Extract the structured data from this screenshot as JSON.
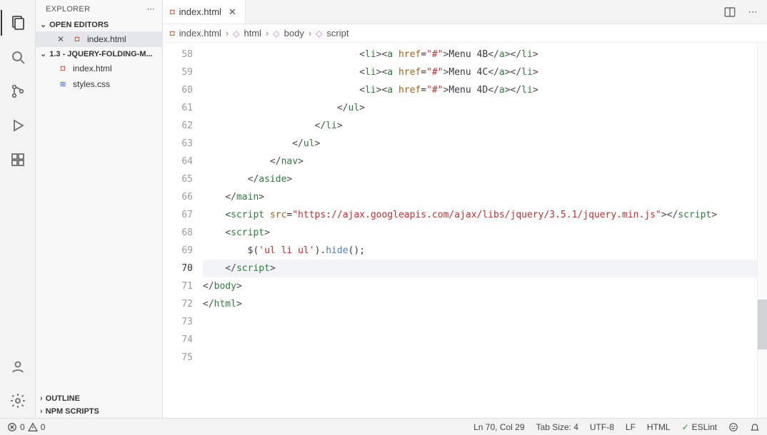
{
  "sidebar": {
    "title": "EXPLORER",
    "sections": {
      "openEditors": {
        "label": "OPEN EDITORS",
        "items": [
          {
            "name": "index.html",
            "type": "html"
          }
        ]
      },
      "project": {
        "label": "1.3 - JQUERY-FOLDING-M...",
        "items": [
          {
            "name": "index.html",
            "type": "html"
          },
          {
            "name": "styles.css",
            "type": "css"
          }
        ]
      },
      "outline": {
        "label": "OUTLINE"
      },
      "npm": {
        "label": "NPM SCRIPTS"
      }
    }
  },
  "tabs": [
    {
      "name": "index.html",
      "type": "html"
    }
  ],
  "breadcrumbs": [
    {
      "label": "index.html",
      "kind": "file-html"
    },
    {
      "label": "html",
      "kind": "element"
    },
    {
      "label": "body",
      "kind": "element"
    },
    {
      "label": "script",
      "kind": "element"
    }
  ],
  "code": {
    "firstLine": 58,
    "activeLine": 70,
    "lines": [
      {
        "n": 58,
        "indent": 28,
        "html": "<span class='tag-br'>&lt;</span><span class='tag'>li</span><span class='tag-br'>&gt;&lt;</span><span class='tag'>a</span> <span class='attr'>href</span>=<span class='str'>\"#\"</span><span class='tag-br'>&gt;</span><span class='text'>Menu 4B</span><span class='tag-br'>&lt;/</span><span class='tag'>a</span><span class='tag-br'>&gt;&lt;/</span><span class='tag'>li</span><span class='tag-br'>&gt;</span>"
      },
      {
        "n": 59,
        "indent": 28,
        "html": "<span class='tag-br'>&lt;</span><span class='tag'>li</span><span class='tag-br'>&gt;&lt;</span><span class='tag'>a</span> <span class='attr'>href</span>=<span class='str'>\"#\"</span><span class='tag-br'>&gt;</span><span class='text'>Menu 4C</span><span class='tag-br'>&lt;/</span><span class='tag'>a</span><span class='tag-br'>&gt;&lt;/</span><span class='tag'>li</span><span class='tag-br'>&gt;</span>"
      },
      {
        "n": 60,
        "indent": 28,
        "html": "<span class='tag-br'>&lt;</span><span class='tag'>li</span><span class='tag-br'>&gt;&lt;</span><span class='tag'>a</span> <span class='attr'>href</span>=<span class='str'>\"#\"</span><span class='tag-br'>&gt;</span><span class='text'>Menu 4D</span><span class='tag-br'>&lt;/</span><span class='tag'>a</span><span class='tag-br'>&gt;&lt;/</span><span class='tag'>li</span><span class='tag-br'>&gt;</span>"
      },
      {
        "n": 61,
        "indent": 24,
        "html": "<span class='tag-br'>&lt;/</span><span class='tag'>ul</span><span class='tag-br'>&gt;</span>"
      },
      {
        "n": 62,
        "indent": 20,
        "html": "<span class='tag-br'>&lt;/</span><span class='tag'>li</span><span class='tag-br'>&gt;</span>"
      },
      {
        "n": 63,
        "indent": 16,
        "html": "<span class='tag-br'>&lt;/</span><span class='tag'>ul</span><span class='tag-br'>&gt;</span>"
      },
      {
        "n": 64,
        "indent": 12,
        "html": "<span class='tag-br'>&lt;/</span><span class='tag'>nav</span><span class='tag-br'>&gt;</span>"
      },
      {
        "n": 65,
        "indent": 8,
        "html": "<span class='tag-br'>&lt;/</span><span class='tag'>aside</span><span class='tag-br'>&gt;</span>"
      },
      {
        "n": 66,
        "indent": 0,
        "html": ""
      },
      {
        "n": 67,
        "indent": 4,
        "html": "<span class='tag-br'>&lt;/</span><span class='tag'>main</span><span class='tag-br'>&gt;</span>"
      },
      {
        "n": 68,
        "indent": 4,
        "html": "<span class='tag-br'>&lt;</span><span class='tag'>script</span> <span class='attr'>src</span>=<span class='str'>\"https://ajax.googleapis.com/ajax/libs/jquery/3.5.1/jquery.min.js\"</span><span class='tag-br'>&gt;&lt;/</span><span class='tag'>script</span><span class='tag-br'>&gt;</span>"
      },
      {
        "n": 69,
        "indent": 4,
        "html": "<span class='tag-br'>&lt;</span><span class='tag'>script</span><span class='tag-br'>&gt;</span>"
      },
      {
        "n": 70,
        "indent": 8,
        "html": "<span class='text'>$(</span><span class='str'>'ul li ul'</span><span class='text'>).</span><span class='fn'>hide</span><span class='text'>()</span><span class='text'>;</span>"
      },
      {
        "n": 71,
        "indent": 4,
        "html": "<span class='tag-br'>&lt;/</span><span class='tag'>script</span><span class='tag-br'>&gt;</span>"
      },
      {
        "n": 72,
        "indent": 0,
        "html": ""
      },
      {
        "n": 73,
        "indent": 0,
        "html": "<span class='tag-br'>&lt;/</span><span class='tag'>body</span><span class='tag-br'>&gt;</span>"
      },
      {
        "n": 74,
        "indent": 0,
        "html": ""
      },
      {
        "n": 75,
        "indent": 0,
        "html": "<span class='tag-br'>&lt;/</span><span class='tag'>html</span><span class='tag-br'>&gt;</span>"
      }
    ]
  },
  "status": {
    "errors": "0",
    "warnings": "0",
    "cursor": "Ln 70, Col 29",
    "tabsize": "Tab Size: 4",
    "encoding": "UTF-8",
    "eol": "LF",
    "lang": "HTML",
    "lint": "ESLint"
  }
}
